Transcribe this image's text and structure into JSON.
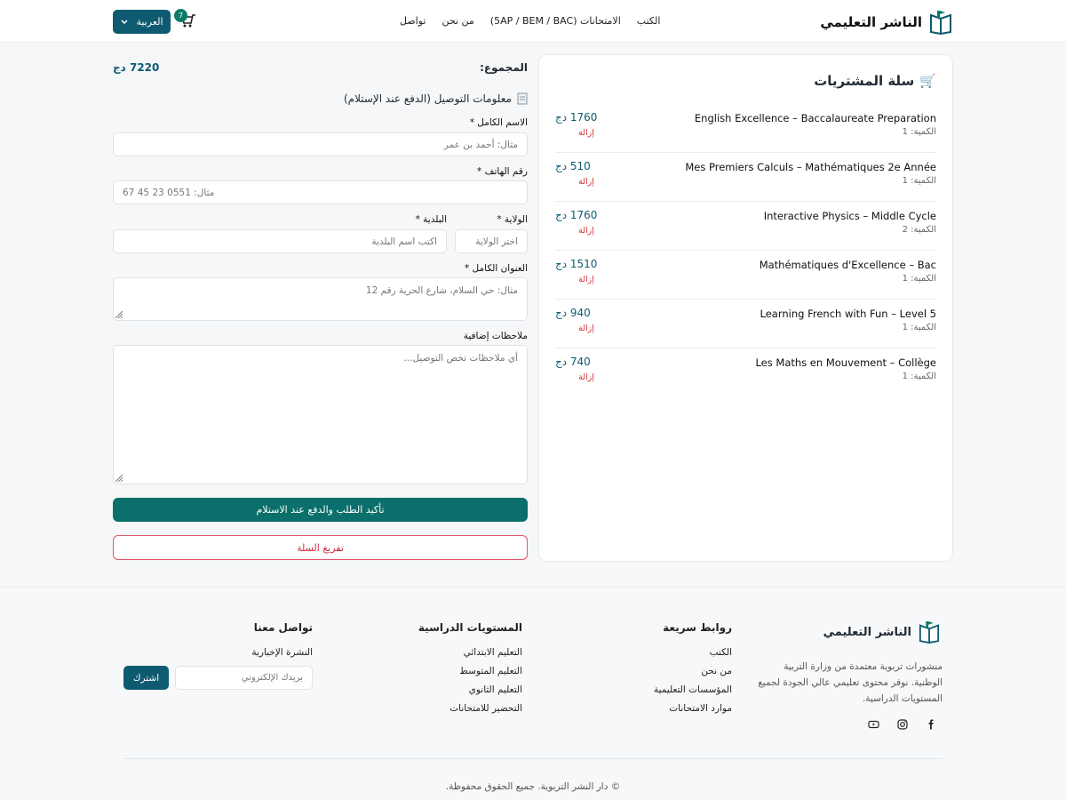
{
  "header": {
    "brand": "الناشر التعليمي",
    "nav": [
      "الكتب",
      "الامتحانات (5AP / BEM / BAC)",
      "من نحن",
      "تواصل"
    ],
    "language": "العربية",
    "cart_count": "7"
  },
  "cart": {
    "title": "سلة المشتريات",
    "items": [
      {
        "name": "English Excellence – Baccalaureate Preparation",
        "qty": "الكمية: 1",
        "price": "1760 دج",
        "remove": "إزالة"
      },
      {
        "name": "Mes Premiers Calculs – Mathématiques 2e Année",
        "qty": "الكمية: 1",
        "price": "510 دج",
        "remove": "إزالة"
      },
      {
        "name": "Interactive Physics – Middle Cycle",
        "qty": "الكمية: 2",
        "price": "1760 دج",
        "remove": "إزالة"
      },
      {
        "name": "Mathématiques d'Excellence – Bac",
        "qty": "الكمية: 1",
        "price": "1510 دج",
        "remove": "إزالة"
      },
      {
        "name": "Learning French with Fun – Level 5",
        "qty": "الكمية: 1",
        "price": "940 دج",
        "remove": "إزالة"
      },
      {
        "name": "Les Maths en Mouvement – Collège",
        "qty": "الكمية: 1",
        "price": "740 دج",
        "remove": "إزالة"
      }
    ]
  },
  "checkout": {
    "total_label": "المجموع:",
    "total_value": "7220 دج",
    "section_title": "معلومات التوصيل (الدفع عند الإستلام)",
    "full_name_label": "الاسم الكامل *",
    "full_name_placeholder": "مثال: أحمد بن عمر",
    "phone_label": "رقم الهاتف *",
    "phone_placeholder": "مثال: 0551 23 45 67",
    "wilaya_label": "الولاية *",
    "wilaya_placeholder": "اختر الولاية",
    "commune_label": "البلدية *",
    "commune_placeholder": "اكتب اسم البلدية",
    "address_label": "العنوان الكامل *",
    "address_placeholder": "مثال: حي السلام، شارع الحرية رقم 12",
    "notes_label": "ملاحظات إضافية",
    "notes_placeholder": "أي ملاحظات تخص التوصيل...",
    "confirm_button": "تأكيد الطلب والدفع عند الاستلام",
    "clear_button": "تفريغ السلة"
  },
  "footer": {
    "brand": "الناشر التعليمي",
    "description": "منشورات تربوية معتمدة من وزارة التربية الوطنية. نوفر محتوى تعليمي عالي الجودة لجميع المستويات الدراسية.",
    "quick_links_title": "روابط سريعة",
    "quick_links": [
      "الكتب",
      "من نحن",
      "المؤسسات التعليمية",
      "موارد الامتحانات"
    ],
    "levels_title": "المستويات الدراسية",
    "levels": [
      "التعليم الابتدائي",
      "التعليم المتوسط",
      "التعليم الثانوي",
      "التحضير للامتحانات"
    ],
    "contact_title": "تواصل معنا",
    "newsletter_label": "النشرة الإخبارية",
    "email_placeholder": "بريدك الإلكتروني",
    "subscribe_button": "اشترك",
    "social_icons": [
      "facebook-icon",
      "instagram-icon",
      "youtube-icon"
    ],
    "copyright": "© دار النشر التربوية. جميع الحقوق محفوظة."
  },
  "colors": {
    "primary": "#0e5a71",
    "accent": "#0b6f6b",
    "danger": "#d32f2f"
  }
}
